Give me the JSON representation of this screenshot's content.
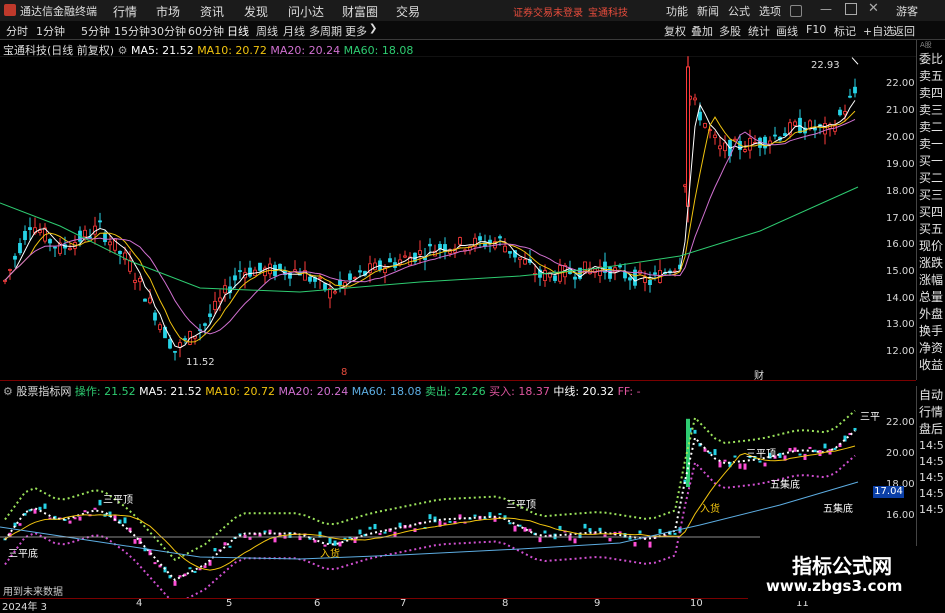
{
  "titlebar": {
    "app_name": "通达信金融终端",
    "menu": [
      "行情",
      "市场",
      "资讯",
      "发现",
      "问小达",
      "财富圈",
      "交易"
    ],
    "login_warning": "证券交易未登录",
    "stock": "宝通科技",
    "right_menu": [
      "功能",
      "新闻",
      "公式",
      "选项"
    ],
    "guest": "游客"
  },
  "toolbar": {
    "periods": [
      "分时",
      "1分钟",
      "5分钟",
      "15分钟",
      "30分钟",
      "60分钟",
      "日线",
      "周线",
      "月线",
      "多周期",
      "更多"
    ],
    "more_icon": "chevron-right-icon",
    "right_buttons": [
      "复权",
      "叠加",
      "多股",
      "统计",
      "画线",
      "F10",
      "标记",
      "+自选",
      "返回"
    ]
  },
  "main_chart": {
    "title": "宝通科技(日线 前复权)",
    "ma_labels": [
      {
        "text": "MA5: 21.52",
        "color": "#ffffff"
      },
      {
        "text": "MA10: 20.72",
        "color": "#f1c40f"
      },
      {
        "text": "MA20: 20.24",
        "color": "#d070d0"
      },
      {
        "text": "MA60: 18.08",
        "color": "#2ecc71"
      }
    ],
    "high_label": "22.93",
    "low_label": "11.52",
    "markers": [
      "8",
      "财"
    ],
    "y_ticks": [
      "22.00",
      "21.00",
      "20.00",
      "19.00",
      "18.00",
      "17.00",
      "16.00",
      "15.00",
      "14.00",
      "13.00",
      "12.00"
    ]
  },
  "sub_chart": {
    "indicator": "股票指标网",
    "values": [
      {
        "text": "操作: 21.52",
        "color": "#2ecc71"
      },
      {
        "text": "MA5: 21.52",
        "color": "#ffffff"
      },
      {
        "text": "MA10: 20.72",
        "color": "#f1c40f"
      },
      {
        "text": "MA20: 20.24",
        "color": "#d070d0"
      },
      {
        "text": "MA60: 18.08",
        "color": "#5dade2"
      },
      {
        "text": "卖出: 22.26",
        "color": "#2ecc71"
      },
      {
        "text": "买入: 18.37",
        "color": "#e056a0"
      },
      {
        "text": "中线: 20.32",
        "color": "#ffffff"
      },
      {
        "text": "FF: -",
        "color": "#e056a0"
      }
    ],
    "y_ticks": [
      "22.00",
      "20.00",
      "18.00",
      "16.00"
    ],
    "price_tag": "17.04",
    "annotations": [
      "三平顶",
      "三平底",
      "入货",
      "五集底",
      "三平"
    ],
    "footer_note": "用到未来数据"
  },
  "sidebar": {
    "items": [
      "委比",
      "卖五",
      "卖四",
      "卖三",
      "卖二",
      "卖一",
      "买一",
      "买二",
      "买三",
      "买四",
      "买五",
      "现价",
      "涨跌",
      "涨幅",
      "总量",
      "外盘",
      "换手",
      "净资",
      "收益"
    ],
    "top_small": "A股"
  },
  "sidebar2": {
    "items": [
      "自动",
      "行情",
      "盘后"
    ],
    "times": [
      "14:5",
      "14:5",
      "14:5",
      "14:5",
      "14:5"
    ]
  },
  "x_axis": {
    "labels": [
      "2024年 3",
      "4",
      "5",
      "6",
      "7",
      "8",
      "9",
      "10",
      "11"
    ]
  },
  "watermark": {
    "line1": "指标公式网",
    "line2": "www.zbgs3.com"
  }
}
